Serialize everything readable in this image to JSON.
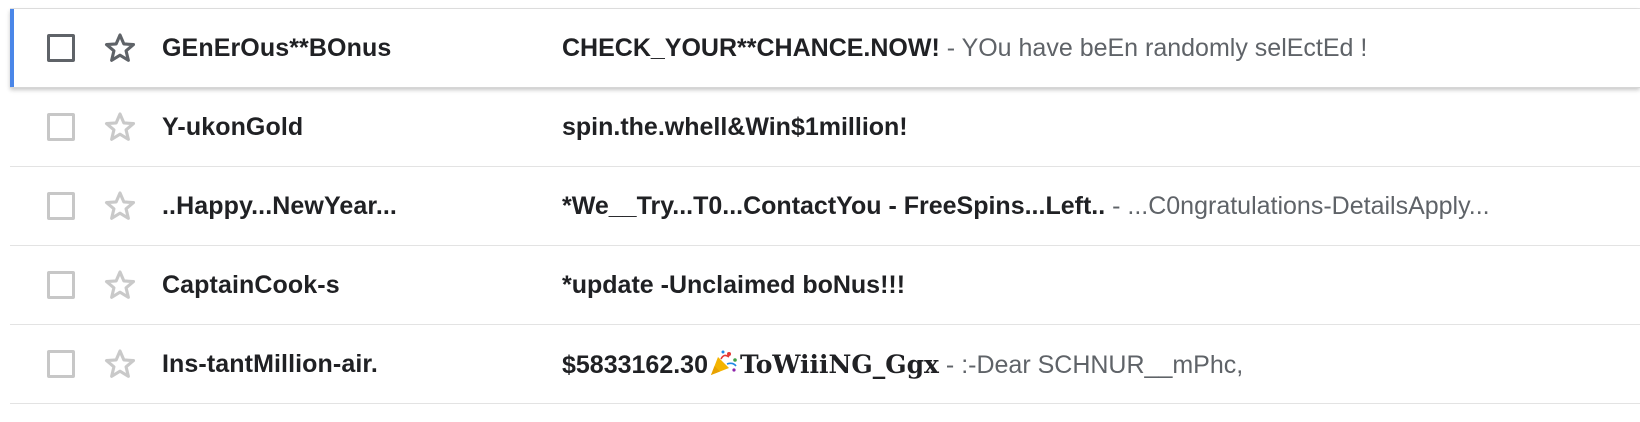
{
  "emails": [
    {
      "sender": "GEnErOus**BOnus",
      "subject": "CHECK_YOUR**CHANCE.NOW!",
      "separator": " - ",
      "snippet": "YOu have beEn randomly selEctEd !",
      "focused": true
    },
    {
      "sender": "Y-ukonGold",
      "subject": "spin.the.whell&Win$1million!",
      "separator": "",
      "snippet": "",
      "focused": false
    },
    {
      "sender": "..Happy...NewYear...",
      "subject": "*We__Try...T0...ContactYou - FreeSpins...Left..",
      "separator": " - ",
      "snippet": "...C0ngratulations-DetailsApply...",
      "focused": false
    },
    {
      "sender": "CaptainCook-s",
      "subject": "*update -Unclaimed boNus!!!",
      "separator": "",
      "snippet": "",
      "focused": false
    },
    {
      "sender": "Ins-tantMillion-air.",
      "subject_part1": "$5833162.30",
      "subject_icon": "party-popper-icon",
      "subject_part2": "ToWiiiNG_Ggx",
      "separator": " - ",
      "snippet": ":-Dear SCHNUR__mPhc,",
      "focused": false
    }
  ],
  "colors": {
    "focus_accent": "#4a86e8",
    "text_primary": "#202124",
    "text_secondary": "#5f6368",
    "divider": "#e3e3e3"
  }
}
